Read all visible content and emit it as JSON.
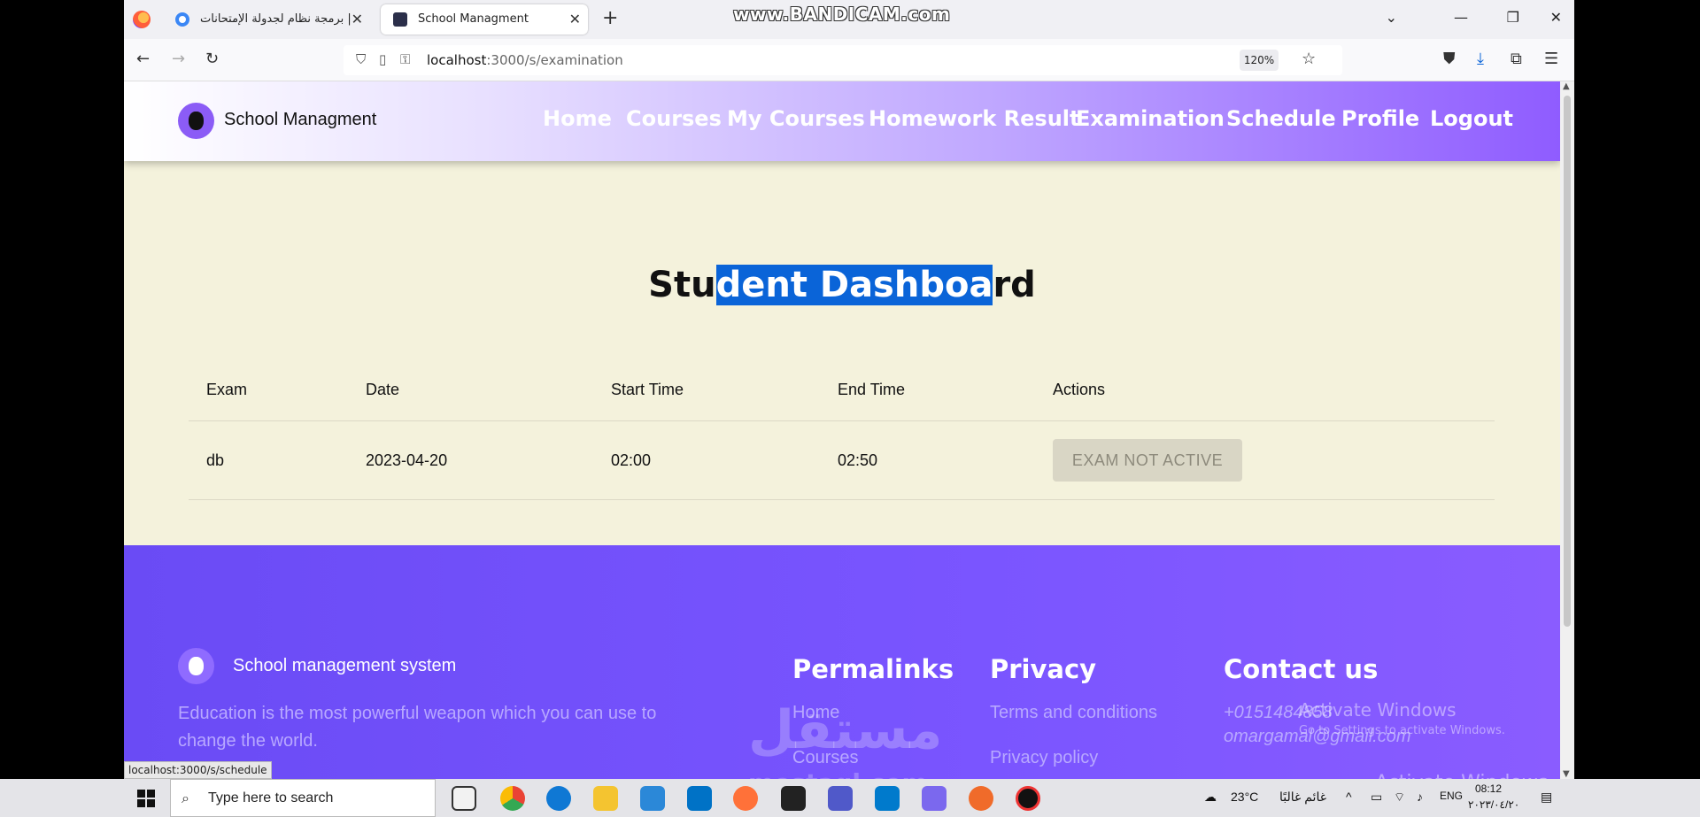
{
  "browser": {
    "tabs": [
      {
        "title": "برمجة نظام لجدولة الإمتحانات |"
      },
      {
        "title": "School Managment"
      }
    ],
    "bandicam_watermark": "www.BANDICAM.com",
    "url_host": "localhost",
    "url_path": ":3000/s/examination",
    "zoom": "120%",
    "status_link": "localhost:3000/s/schedule"
  },
  "header": {
    "brand": "School Managment",
    "nav": [
      "Home",
      "Courses",
      "My Courses",
      "Homework Result",
      "Examination",
      "Schedule",
      "Profile",
      "Logout"
    ]
  },
  "dashboard": {
    "title_before": "Stu",
    "title_selected": "dent Dashboa",
    "title_after": "rd",
    "columns": [
      "Exam",
      "Date",
      "Start Time",
      "End Time",
      "Actions"
    ],
    "rows": [
      {
        "exam": "db",
        "date": "2023-04-20",
        "start": "02:00",
        "end": "02:50",
        "action": "EXAM NOT ACTIVE"
      }
    ]
  },
  "footer": {
    "brand": "School management system",
    "description": "Education is the most powerful weapon which you can use to change the world.",
    "permalinks_title": "Permalinks",
    "permalinks": [
      "Home",
      "Courses"
    ],
    "privacy_title": "Privacy",
    "privacy_links": [
      "Terms and conditions",
      "Privacy policy"
    ],
    "contact_title": "Contact us",
    "phone": "+0151484858",
    "email": "omargamal@gmail.com"
  },
  "overlays": {
    "watermark_arabic": "مستقل",
    "watermark_latin": "mostaql.com",
    "activate_title": "Activate Windows",
    "activate_sub": "Go to Settings to activate Windows."
  },
  "taskbar": {
    "search_placeholder": "Type here to search",
    "weather": "23°C",
    "weather_desc": "غائم غالبًا",
    "lang": "ENG",
    "time": "08:12",
    "date": "٢٠٢٣/٠٤/٢٠"
  }
}
